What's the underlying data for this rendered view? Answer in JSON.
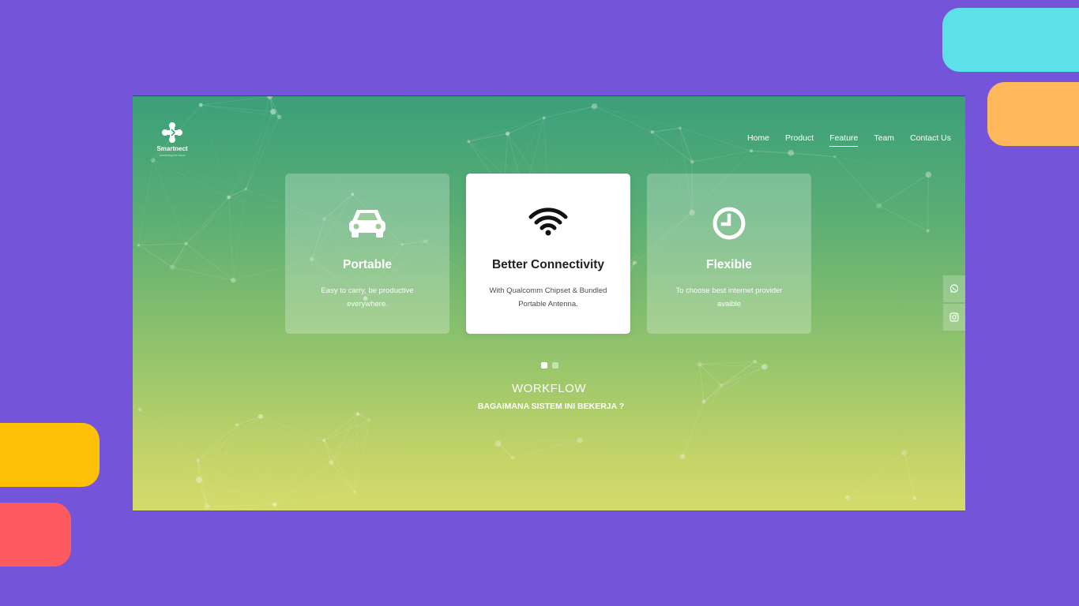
{
  "colors": {
    "background": "#7455d9",
    "deco": [
      "#5ee0e8",
      "#ffb75c",
      "#ffc107",
      "#ff5a5f"
    ],
    "gradient_top": "#3b9f79",
    "gradient_bottom": "#d4dc6b"
  },
  "logo": {
    "name": "Smartnect",
    "tagline": "connecting the future",
    "icon": "smartnect-logo-icon"
  },
  "nav": {
    "items": [
      {
        "label": "Home"
      },
      {
        "label": "Product"
      },
      {
        "label": "Feature",
        "active": true
      },
      {
        "label": "Team"
      },
      {
        "label": "Contact Us"
      }
    ]
  },
  "features": [
    {
      "icon": "car-icon",
      "title": "Portable",
      "desc": "Easy to carry, be productive everywhere."
    },
    {
      "icon": "wifi-icon",
      "title": "Better Connectivity",
      "desc": "With Qualcomm Chipset & Bundled Portable Antenna.",
      "highlighted": true
    },
    {
      "icon": "clock-icon",
      "title": "Flexible",
      "desc": "To choose best internet provider avaible"
    }
  ],
  "carousel": {
    "current_slide": 1,
    "total_slides": 2
  },
  "workflow": {
    "title": "WORKFLOW",
    "subtitle": "BAGAIMANA SISTEM INI BEKERJA ?"
  },
  "social": [
    {
      "icon": "whatsapp-icon"
    },
    {
      "icon": "instagram-icon"
    }
  ]
}
